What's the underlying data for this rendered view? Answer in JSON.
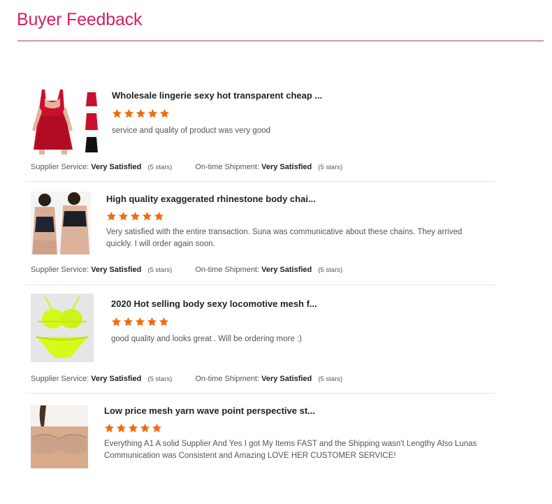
{
  "page": {
    "heading": "Buyer Feedback"
  },
  "colors": {
    "heading": "#d81e63",
    "rule": "#b5357c",
    "star": "#f26b0f"
  },
  "reviews": [
    {
      "product_title": "Wholesale lingerie sexy hot transparent cheap ...",
      "rating": 5,
      "comment": "service and quality of product was very good",
      "supplier_label": "Supplier Service:",
      "supplier_value": "Very Satisfied",
      "supplier_stars": "(5 stars)",
      "shipment_label": "On-time Shipment:",
      "shipment_value": "Very Satisfied",
      "shipment_stars": "(5 stars)",
      "image_icon": "red-lingerie-photo"
    },
    {
      "product_title": "High quality exaggerated rhinestone body chai...",
      "rating": 5,
      "comment": "Very satisfied with the entire transaction.  Suna was communicative about these chains.  They arrived quickly.  I will order again soon.",
      "supplier_label": "Supplier Service:",
      "supplier_value": "Very Satisfied",
      "supplier_stars": "(5 stars)",
      "shipment_label": "On-time Shipment:",
      "shipment_value": "Very Satisfied",
      "shipment_stars": "(5 stars)",
      "image_icon": "black-bra-photo"
    },
    {
      "product_title": "2020 Hot selling body sexy locomotive mesh f...",
      "rating": 5,
      "comment": "good quality  and looks great . Will be ordering more :)",
      "supplier_label": "Supplier Service:",
      "supplier_value": "Very Satisfied",
      "supplier_stars": "(5 stars)",
      "shipment_label": "On-time Shipment:",
      "shipment_value": "Very Satisfied",
      "shipment_stars": "(5 stars)",
      "image_icon": "neon-bikini-photo"
    },
    {
      "product_title": "Low price mesh yarn wave point perspective st...",
      "rating": 5,
      "comment": "Everything A1  A solid Supplier And Yes I got My Items FAST and the Shipping wasn't Lengthy Also Lunas Communication was Consistent and Amazing LOVE HER CUSTOMER SERVICE!",
      "image_icon": "strapless-bra-photo"
    }
  ]
}
